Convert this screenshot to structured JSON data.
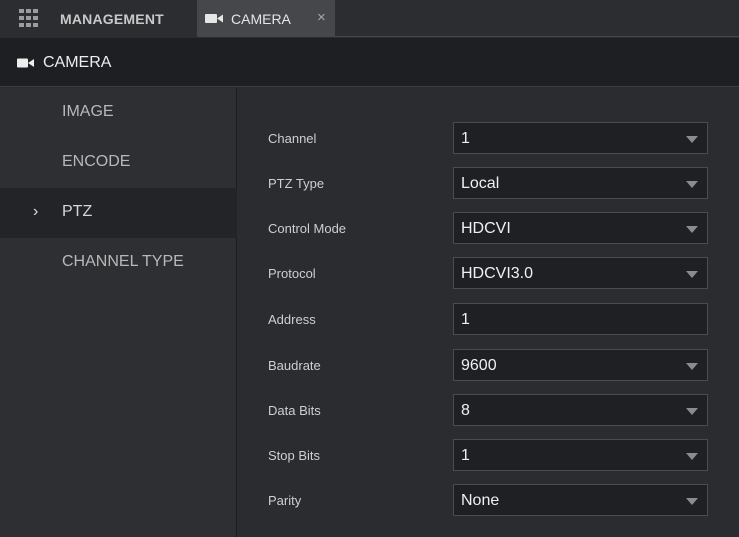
{
  "tabs": {
    "management_label": "MANAGEMENT",
    "camera_label": "CAMERA",
    "close_glyph": "×"
  },
  "header": {
    "title": "CAMERA"
  },
  "sidebar": {
    "items": [
      {
        "label": "IMAGE",
        "active": false
      },
      {
        "label": "ENCODE",
        "active": false
      },
      {
        "label": "PTZ",
        "active": true
      },
      {
        "label": "CHANNEL TYPE",
        "active": false
      }
    ],
    "active_marker": "›"
  },
  "form": {
    "fields": [
      {
        "label": "Channel",
        "value": "1",
        "type": "select"
      },
      {
        "label": "PTZ Type",
        "value": "Local",
        "type": "select"
      },
      {
        "label": "Control Mode",
        "value": "HDCVI",
        "type": "select"
      },
      {
        "label": "Protocol",
        "value": "HDCVI3.0",
        "type": "select"
      },
      {
        "label": "Address",
        "value": "1",
        "type": "input"
      },
      {
        "label": "Baudrate",
        "value": "9600",
        "type": "select"
      },
      {
        "label": "Data Bits",
        "value": "8",
        "type": "select"
      },
      {
        "label": "Stop Bits",
        "value": "1",
        "type": "select"
      },
      {
        "label": "Parity",
        "value": "None",
        "type": "select"
      }
    ]
  },
  "icons": {
    "grid": "grid-icon",
    "camera": "camera-icon",
    "close": "close-icon",
    "dropdown": "chevron-down-icon"
  }
}
